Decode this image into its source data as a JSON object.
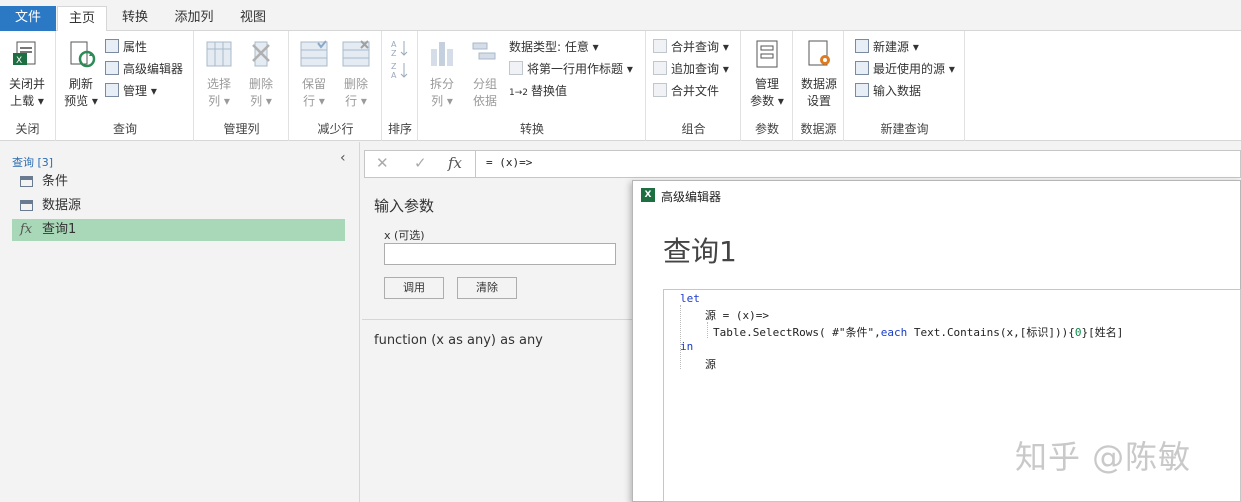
{
  "tabs": {
    "file": "文件",
    "home": "主页",
    "transform": "转换",
    "add_column": "添加列",
    "view": "视图"
  },
  "ribbon": {
    "close": {
      "btn_line1": "关闭并",
      "btn_line2": "上载",
      "label": "关闭"
    },
    "query": {
      "refresh_line1": "刷新",
      "refresh_line2": "预览",
      "properties": "属性",
      "advanced_editor": "高级编辑器",
      "manage": "管理",
      "label": "查询"
    },
    "manage_cols": {
      "choose_line1": "选择",
      "choose_line2": "列",
      "remove_line1": "删除",
      "remove_line2": "列",
      "label": "管理列"
    },
    "reduce_rows": {
      "keep_line1": "保留",
      "keep_line2": "行",
      "remove_line1": "删除",
      "remove_line2": "行",
      "label": "减少行"
    },
    "sort": {
      "label": "排序"
    },
    "transform": {
      "split_line1": "拆分",
      "split_line2": "列",
      "group_line1": "分组",
      "group_line2": "依据",
      "data_type": "数据类型: 任意",
      "first_row_header": "将第一行用作标题",
      "replace_values": "替换值",
      "label": "转换"
    },
    "combine": {
      "merge": "合并查询",
      "append": "追加查询",
      "combine_files": "合并文件",
      "label": "组合"
    },
    "params": {
      "btn_line1": "管理",
      "btn_line2": "参数",
      "label": "参数"
    },
    "datasource": {
      "btn_line1": "数据源",
      "btn_line2": "设置",
      "label": "数据源"
    },
    "new_query": {
      "new_source": "新建源",
      "recent_sources": "最近使用的源",
      "enter_data": "输入数据",
      "label": "新建查询"
    }
  },
  "queries": {
    "header": "查询 [3]",
    "items": [
      "条件",
      "数据源",
      "查询1"
    ]
  },
  "formula_bar": {
    "fx": "fx",
    "text": "= (x)=>"
  },
  "params_panel": {
    "title": "输入参数",
    "param_label": "x (可选)",
    "invoke": "调用",
    "clear": "清除",
    "signature": "function (x as any) as any"
  },
  "advanced_editor": {
    "window_title": "高级编辑器",
    "query_name": "查询1",
    "code": {
      "l1_kw": "let",
      "l2": "源 = (x)=>",
      "l3_a": "Table.SelectRows( #\"条件\",",
      "l3_kw": "each",
      "l3_b": " Text.Contains(x,[标识])){",
      "l3_num": "0",
      "l3_c": "}[姓名]",
      "l4_kw": "in",
      "l5": "源"
    }
  },
  "watermark": "知乎 @陈敏"
}
